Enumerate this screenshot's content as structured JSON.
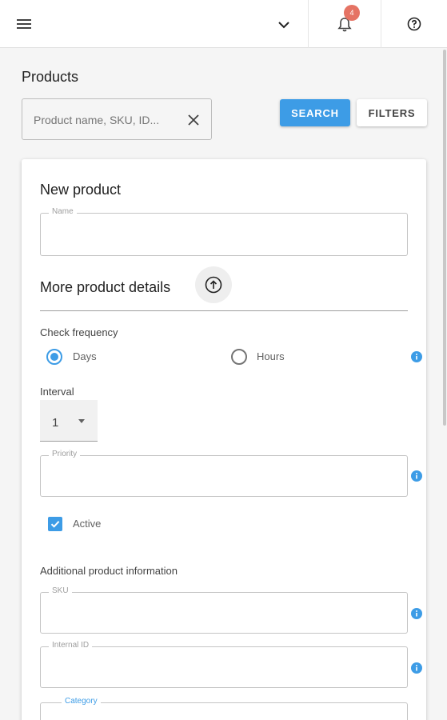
{
  "topbar": {
    "menu_icon": "hamburger-menu-icon",
    "company_select_value": "",
    "notifications_count": "4",
    "bell_icon": "bell-icon",
    "help_icon": "help-circle-icon"
  },
  "page": {
    "title": "Products",
    "search_placeholder": "Product name, SKU, ID...",
    "search_label": "SEARCH",
    "filters_label": "FILTERS"
  },
  "form": {
    "title": "New product",
    "name_label": "Name",
    "more_details_title": "More product details",
    "check_frequency_label": "Check frequency",
    "option_days": "Days",
    "option_hours": "Hours",
    "check_frequency_selected": "Days",
    "interval_label": "Interval",
    "interval_value": "1",
    "priority_label": "Priority",
    "active_label": "Active",
    "active_checked": true,
    "additional_info_title": "Additional product information",
    "sku_label": "SKU",
    "internal_id_label": "Internal ID",
    "category_label": "Category"
  },
  "colors": {
    "accent": "#3d9ce6",
    "badge": "#e57364"
  }
}
